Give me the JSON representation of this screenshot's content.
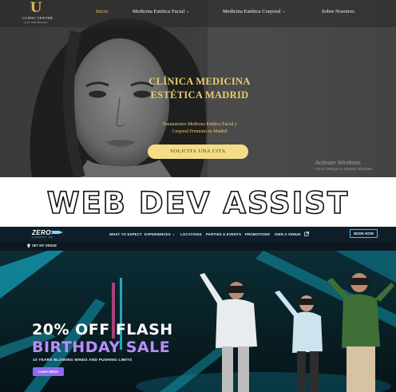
{
  "clinic_site": {
    "logo": {
      "letter": "U",
      "name": "CLINIC CENTER",
      "subtitle": "by Dr. Ubeda Benavides"
    },
    "nav": [
      {
        "label": "Inicio",
        "active": true,
        "has_dropdown": false
      },
      {
        "label": "Medicina Estética Facial",
        "active": false,
        "has_dropdown": true
      },
      {
        "label": "Medicina Estética Corporal",
        "active": false,
        "has_dropdown": true
      },
      {
        "label": "Sobre Nosotros",
        "active": false,
        "has_dropdown": false
      }
    ],
    "hero": {
      "title_line1": "CLÍNICA MEDICINA",
      "title_line2": "ESTÉTICA MADRID",
      "tagline_line1": "Tratamientos Medicina Estética Facial y",
      "tagline_line2": "Corporal Premium en Madrid",
      "cta_label": "SOLICITA UNA CITA"
    },
    "activate_windows": {
      "title": "Activate Windows",
      "subtitle": "Go to Settings to activate Windows."
    },
    "colors": {
      "gold": "#e9cf6a",
      "cta_bg": "#f4dd86",
      "nav_active": "#e6c84e"
    }
  },
  "banner": {
    "text": "WEB DEV ASSIST"
  },
  "zero_site": {
    "logo": {
      "name": "ZERO",
      "tagline": "LATENCY VR"
    },
    "nav": [
      {
        "label": "WHAT TO EXPECT",
        "has_dropdown": false
      },
      {
        "label": "EXPERIENCES",
        "has_dropdown": true
      },
      {
        "label": "LOCATIONS",
        "has_dropdown": false
      },
      {
        "label": "PARTIES & EVENTS",
        "has_dropdown": false
      },
      {
        "label": "PROMOTIONS",
        "has_dropdown": false
      },
      {
        "label": "OWN A VENUE",
        "has_dropdown": false
      }
    ],
    "external_link_icon": "external-link-icon",
    "book_now_label": "BOOK NOW",
    "venue_label": "SET MY VENUE",
    "venue_icon": "location-pin-icon",
    "promo": {
      "line1": "20% OFF FLASH",
      "line2": "BIRTHDAY SALE",
      "subtitle": "10 YEARS BLOWING MINDS AND PUSHING LIMITS",
      "button_label": "Learn More"
    },
    "colors": {
      "accent_purple": "#8f6cf3",
      "accent_blue": "#5ab8e6",
      "nav_bg": "#0f1f29"
    }
  }
}
